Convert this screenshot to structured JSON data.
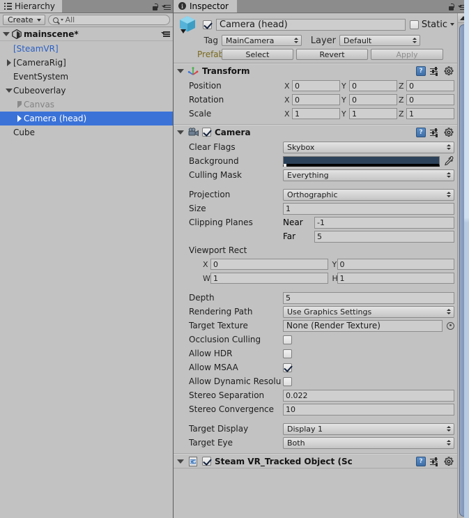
{
  "hierarchy": {
    "tab_label": "Hierarchy",
    "tab_icon": "hierarchy-list-icon",
    "lock_icon": "lock-icon",
    "menu_icon": "panel-menu-icon",
    "create_button": "Create",
    "search_placeholder": "All",
    "search_value": "",
    "scene_name": "mainscene*",
    "items": [
      {
        "label": "[SteamVR]",
        "indent": 1,
        "expander": "none",
        "style": "prefab",
        "selected": false
      },
      {
        "label": "[CameraRig]",
        "indent": 1,
        "expander": "closed",
        "style": "normal",
        "selected": false
      },
      {
        "label": "EventSystem",
        "indent": 1,
        "expander": "none",
        "style": "normal",
        "selected": false
      },
      {
        "label": "Cubeoverlay",
        "indent": 1,
        "expander": "open",
        "style": "normal",
        "selected": false
      },
      {
        "label": "Canvas",
        "indent": 2,
        "expander": "closed",
        "style": "inactive",
        "selected": false
      },
      {
        "label": "Camera (head)",
        "indent": 2,
        "expander": "closed",
        "style": "normal",
        "selected": true
      },
      {
        "label": "Cube",
        "indent": 1,
        "expander": "none",
        "style": "normal",
        "selected": false
      }
    ]
  },
  "inspector": {
    "tab_label": "Inspector",
    "tab_icon": "info-icon",
    "object": {
      "icon": "prefab-cube-icon",
      "enabled": true,
      "name": "Camera (head)",
      "static_label": "Static",
      "static_checked": false,
      "tag_label": "Tag",
      "tag_value": "MainCamera",
      "layer_label": "Layer",
      "layer_value": "Default",
      "prefab_label": "Prefab",
      "prefab_buttons": [
        "Select",
        "Revert",
        "Apply"
      ],
      "apply_disabled": true
    },
    "components": [
      {
        "name": "Transform",
        "icon": "transform-gizmo-icon",
        "has_checkbox": false,
        "expanded": true,
        "rows": [
          {
            "type": "vector3",
            "label": "Position",
            "axes": [
              "X",
              "Y",
              "Z"
            ],
            "values": [
              "0",
              "0",
              "0"
            ]
          },
          {
            "type": "vector3",
            "label": "Rotation",
            "axes": [
              "X",
              "Y",
              "Z"
            ],
            "values": [
              "0",
              "0",
              "0"
            ]
          },
          {
            "type": "vector3",
            "label": "Scale",
            "axes": [
              "X",
              "Y",
              "Z"
            ],
            "values": [
              "1",
              "1",
              "1"
            ]
          }
        ]
      },
      {
        "name": "Camera",
        "icon": "movie-camera-icon",
        "has_checkbox": true,
        "checked": true,
        "expanded": true,
        "rows": [
          {
            "type": "dropdown",
            "label": "Clear Flags",
            "value": "Skybox"
          },
          {
            "type": "color",
            "label": "Background",
            "color": "#2b4159",
            "picker_icon": "eyedropper-icon"
          },
          {
            "type": "dropdown",
            "label": "Culling Mask",
            "value": "Everything"
          },
          {
            "type": "spacer"
          },
          {
            "type": "dropdown",
            "label": "Projection",
            "value": "Orthographic"
          },
          {
            "type": "text",
            "label": "Size",
            "value": "1"
          },
          {
            "type": "pair",
            "label": "Clipping Planes",
            "sub_label": "Near",
            "value": "-1"
          },
          {
            "type": "pair",
            "label": "",
            "sub_label": "Far",
            "value": "5"
          },
          {
            "type": "header",
            "label": "Viewport Rect"
          },
          {
            "type": "vec2",
            "label": "",
            "a_label": "X",
            "a_value": "0",
            "b_label": "Y",
            "b_value": "0"
          },
          {
            "type": "vec2",
            "label": "",
            "a_label": "W",
            "a_value": "1",
            "b_label": "H",
            "b_value": "1"
          },
          {
            "type": "spacer"
          },
          {
            "type": "text",
            "label": "Depth",
            "value": "5"
          },
          {
            "type": "dropdown",
            "label": "Rendering Path",
            "value": "Use Graphics Settings"
          },
          {
            "type": "object",
            "label": "Target Texture",
            "value": "None (Render Texture)"
          },
          {
            "type": "check",
            "label": "Occlusion Culling",
            "checked": false
          },
          {
            "type": "check",
            "label": "Allow HDR",
            "checked": false
          },
          {
            "type": "check",
            "label": "Allow MSAA",
            "checked": true
          },
          {
            "type": "check",
            "label": "Allow Dynamic Resolu",
            "checked": false
          },
          {
            "type": "text",
            "label": "Stereo Separation",
            "value": "0.022"
          },
          {
            "type": "text",
            "label": "Stereo Convergence",
            "value": "10"
          },
          {
            "type": "spacer"
          },
          {
            "type": "dropdown",
            "label": "Target Display",
            "value": "Display 1"
          },
          {
            "type": "dropdown",
            "label": "Target Eye",
            "value": "Both"
          }
        ]
      },
      {
        "name": "Steam VR_Tracked Object (Sc",
        "icon": "csharp-script-icon",
        "has_checkbox": true,
        "checked": true,
        "expanded": true,
        "rows": []
      }
    ],
    "component_tools": {
      "help_icon": "help-book-icon",
      "help_glyph": "?",
      "preset_icon": "preset-sliders-icon",
      "gear_icon": "gear-icon"
    },
    "scrollbar": {
      "up_arrow_icon": "scroll-up-arrow-icon",
      "thumb": "vertical-scroll-thumb"
    }
  },
  "colors": {
    "selection_blue": "#3a72d8",
    "prefab_blue": "#2a5fc4",
    "panel_bg": "#c2c2c2",
    "tabbar_bg": "#8c8c8c",
    "camera_background": "#2b4159"
  }
}
